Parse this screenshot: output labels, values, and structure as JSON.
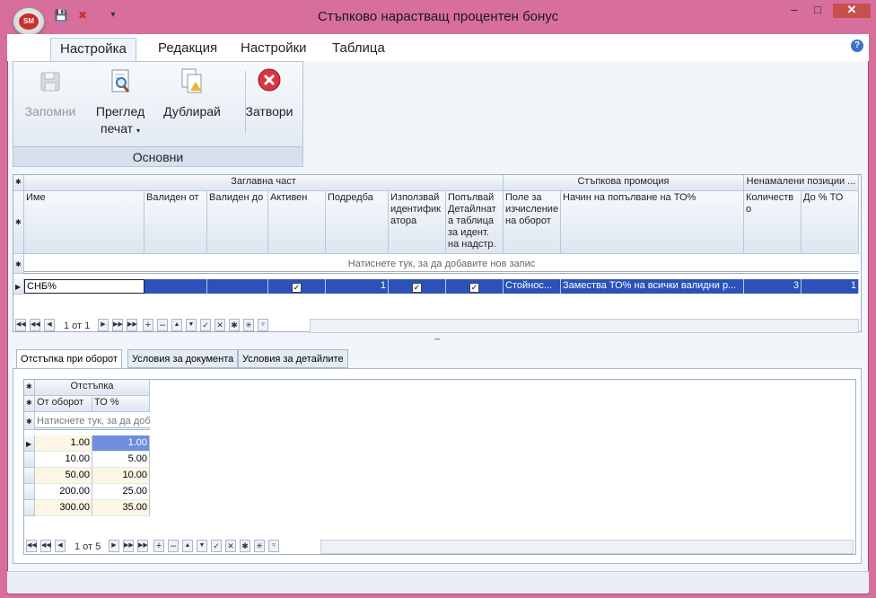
{
  "window": {
    "title": "Стъпково нарастващ процентен бонус",
    "logo_text": "SM"
  },
  "ribbon_tabs": [
    "Настройка",
    "Редакция",
    "Настройки",
    "Таблица"
  ],
  "ribbon": {
    "buttons": {
      "save": "Запомни",
      "preview_line1": "Преглед",
      "preview_line2": "печат",
      "duplicate": "Дублирай",
      "close": "Затвори"
    },
    "group_label": "Основни"
  },
  "main_grid": {
    "bands": [
      "Заглавна част",
      "Стъпкова промоция",
      "Ненамалени позиции ..."
    ],
    "columns": [
      "Име",
      "Валиден от",
      "Валиден до",
      "Активен",
      "Подредба",
      "Използвай идентификатора",
      "Попълвай Детайлната таблица за идент. на надстр.",
      "Поле за изчисление на оборот",
      "Начин на попълване на ТО%",
      "Количество",
      "До % ТО"
    ],
    "new_row_hint": "Натиснете тук, за да добавите нов запис",
    "row": {
      "name": "СНБ%",
      "valid_from": "",
      "valid_to": "",
      "active": true,
      "order": "1",
      "use_id": true,
      "fill_detail": true,
      "turnover_field": "Стойнос...",
      "fill_method": "Замества ТО% на всички валидни р...",
      "quantity": "3",
      "to_percent": "1"
    },
    "nav_record": "1 от 1"
  },
  "bottom_tabs": [
    "Отстъпка при оборот",
    "Условия за документа",
    "Условия за детайлите"
  ],
  "sub_grid": {
    "band": "Отстъпка",
    "columns": [
      "От оборот",
      "ТО %"
    ],
    "new_row_hint": "Натиснете тук, за да доб",
    "rows": [
      {
        "from": "1.00",
        "to": "1.00"
      },
      {
        "from": "10.00",
        "to": "5.00"
      },
      {
        "from": "50.00",
        "to": "10.00"
      },
      {
        "from": "200.00",
        "to": "25.00"
      },
      {
        "from": "300.00",
        "to": "35.00"
      }
    ],
    "nav_record": "1 от 5"
  }
}
